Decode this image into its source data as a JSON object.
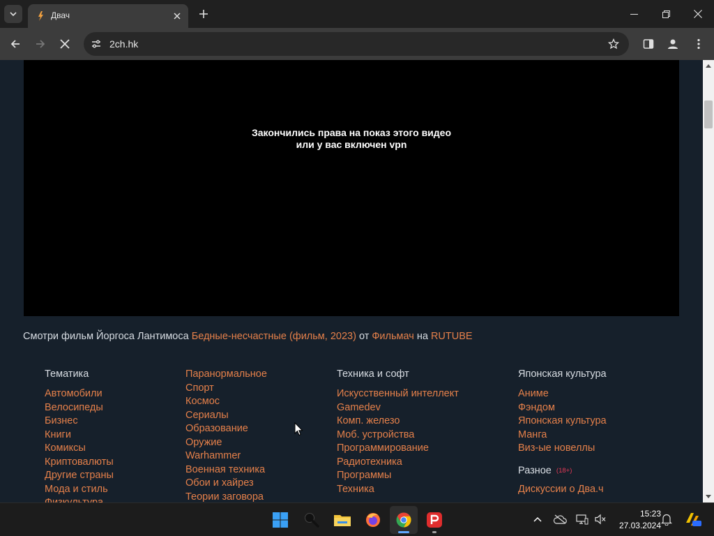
{
  "browser": {
    "tab": {
      "title": "Двач"
    },
    "url": "2ch.hk"
  },
  "video": {
    "message_line1": "Закончились права на показ этого видео",
    "message_line2": "или у вас включен vpn"
  },
  "caption": {
    "prefix": "Смотри фильм Йоргоса Лантимоса",
    "film_link": "Бедные-несчастные (фильм, 2023)",
    "from_word": "от",
    "channel_link": "Фильмач",
    "on_word": "на",
    "platform_link": "RUTUBE"
  },
  "directory": {
    "col1": {
      "heading": "Тематика",
      "items": [
        "Автомобили",
        "Велосипеды",
        "Бизнес",
        "Книги",
        "Комиксы",
        "Криптовалюты",
        "Другие страны",
        "Мода и стиль",
        "Физкультура"
      ]
    },
    "col2": {
      "items": [
        "Паранормальное",
        "Спорт",
        "Космос",
        "Сериалы",
        "Образование",
        "Оружие",
        "Warhammer",
        "Военная техника",
        "Обои и хайрез",
        "Теории заговора"
      ]
    },
    "col3": {
      "heading": "Техника и софт",
      "items": [
        "Искусственный интеллект",
        "Gamedev",
        "Комп. железо",
        "Моб. устройства",
        "Программирование",
        "Радиотехника",
        "Программы",
        "Техника"
      ]
    },
    "col4": {
      "heading": "Японская культура",
      "items": [
        "Аниме",
        "Фэндом",
        "Японская культура",
        "Манга",
        "Виз-ые новеллы"
      ],
      "misc_heading": "Разное",
      "misc_badge": "(18+)",
      "misc_items": [
        "Дискуссии о Два.ч"
      ]
    }
  },
  "taskbar": {
    "time": "15:23",
    "date": "27.03.2024"
  },
  "colors": {
    "page_bg": "#16202b",
    "link": "#e5804a",
    "text": "#d8dde3",
    "badge": "#e53957"
  }
}
